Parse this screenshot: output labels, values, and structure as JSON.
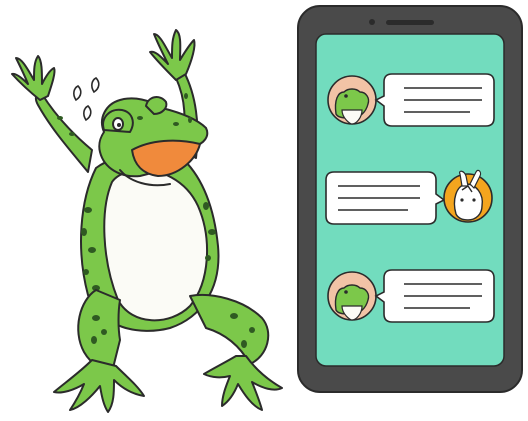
{
  "scene": {
    "subject": "frog-panicking-at-phone",
    "background": "#ffffff"
  },
  "colors": {
    "frog_green": "#7cc84a",
    "frog_dark_green": "#4e9a2b",
    "frog_spots": "#2f5a22",
    "frog_belly": "#fbfbf6",
    "mouth_orange": "#f08a3c",
    "outline": "#2b2b2b",
    "phone_body": "#4a4a4a",
    "phone_screen": "#72dcbe",
    "bubble_fill": "#ffffff",
    "avatar_frog_bg": "#f2c3a6",
    "avatar_rabbit_bg": "#f4a51e"
  },
  "icons": {
    "sweat_drops": "sweat-drops-icon",
    "avatar_frog": "frog-avatar-icon",
    "avatar_rabbit": "rabbit-avatar-icon"
  },
  "chat": {
    "messages": [
      {
        "sender": "frog",
        "side": "left",
        "text_lines": 3
      },
      {
        "sender": "rabbit",
        "side": "right",
        "text_lines": 3
      },
      {
        "sender": "frog",
        "side": "left",
        "text_lines": 3
      }
    ]
  }
}
